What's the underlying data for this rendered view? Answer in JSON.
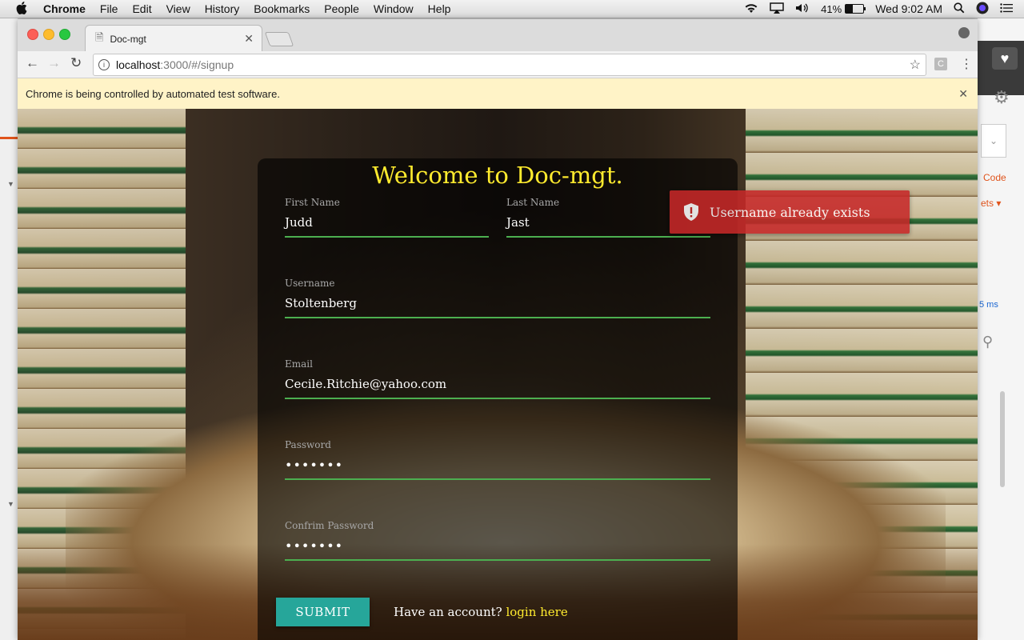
{
  "menubar": {
    "app": "Chrome",
    "items": [
      "File",
      "Edit",
      "View",
      "History",
      "Bookmarks",
      "People",
      "Window",
      "Help"
    ],
    "battery_percent": "41%",
    "clock": "Wed 9:02 AM"
  },
  "browser": {
    "tab_title": "Doc-mgt",
    "url_host": "localhost",
    "url_path": ":3000/#/signup",
    "extension_label": "C",
    "infobar_message": "Chrome is being controlled by automated test software."
  },
  "background_app": {
    "code_label": "Code",
    "ets_label": "ets ▾",
    "ms_label": "5 ms"
  },
  "signup": {
    "heading": "Welcome to Doc-mgt.",
    "first_name": {
      "label": "First Name",
      "value": "Judd"
    },
    "last_name": {
      "label": "Last Name",
      "value": "Jast"
    },
    "username": {
      "label": "Username",
      "value": "Stoltenberg"
    },
    "email": {
      "label": "Email",
      "value": "Cecile.Ritchie@yahoo.com"
    },
    "password": {
      "label": "Password",
      "value": "•••••••"
    },
    "confirm_password": {
      "label": "Confrim Password",
      "value": "•••••••"
    },
    "submit_label": "SUBMIT",
    "have_account_text": "Have an account?",
    "login_link": "login here"
  },
  "toast": {
    "message": "Username already exists",
    "color": "#c62828"
  },
  "colors": {
    "accent_yellow": "#ffeb2e",
    "input_underline": "#4caf50",
    "submit_button": "#26a69a"
  }
}
